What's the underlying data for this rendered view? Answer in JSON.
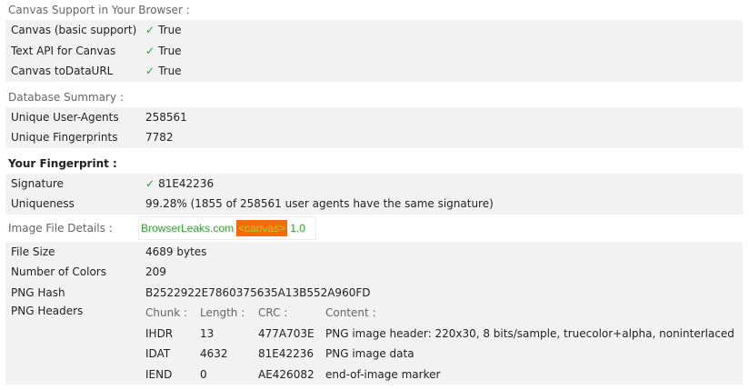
{
  "canvas_support": {
    "title": "Canvas Support in Your Browser :",
    "rows": [
      {
        "label": "Canvas (basic support)",
        "check": "✓",
        "value": "True"
      },
      {
        "label": "Text API for Canvas",
        "check": "✓",
        "value": "True"
      },
      {
        "label": "Canvas toDataURL",
        "check": "✓",
        "value": "True"
      }
    ]
  },
  "database_summary": {
    "title": "Database Summary :",
    "rows": [
      {
        "label": "Unique User-Agents",
        "value": "258561"
      },
      {
        "label": "Unique Fingerprints",
        "value": "7782"
      }
    ]
  },
  "fingerprint": {
    "title": "Your Fingerprint :",
    "signature_label": "Signature",
    "signature_check": "✓",
    "signature_value": "81E42236",
    "uniqueness_label": "Uniqueness",
    "uniqueness_value": "99.28% (1855 of 258561 user agents have the same signature)"
  },
  "image_details": {
    "title": "Image File Details :",
    "canvas_text_brand": "BrowserLeaks.com",
    "canvas_text_tag": "<canvas>",
    "canvas_text_version": "1.0",
    "rows": [
      {
        "label": "File Size",
        "value": "4689 bytes"
      },
      {
        "label": "Number of Colors",
        "value": "209"
      },
      {
        "label": "PNG Hash",
        "value": "B2522922E7860375635A13B552A960FD"
      }
    ],
    "png_headers_label": "PNG Headers",
    "png_columns": [
      "Chunk :",
      "Length :",
      "CRC :",
      "Content :"
    ],
    "png_rows": [
      [
        "IHDR",
        "13",
        "477A703E",
        "PNG image header: 220x30, 8 bits/sample, truecolor+alpha, noninterlaced"
      ],
      [
        "IDAT",
        "4632",
        "81E42236",
        "PNG image data"
      ],
      [
        "IEND",
        "0",
        "AE426082",
        "end-of-image marker"
      ]
    ]
  },
  "colors": {
    "check": "#2e9e3f",
    "row_shade": "#f2f2f2",
    "section_title": "#666666",
    "canvas_tag_bg": "#ff6a00"
  }
}
